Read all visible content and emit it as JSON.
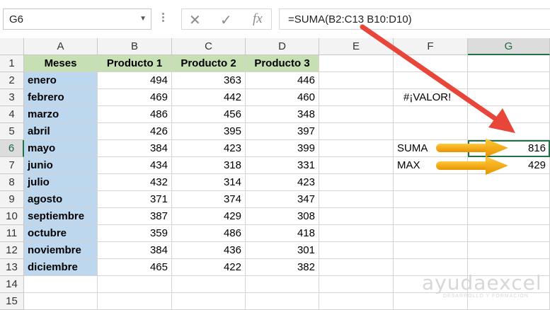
{
  "name_box": {
    "value": "G6"
  },
  "formula_bar": {
    "cancel_icon": "close-icon",
    "enter_icon": "check-icon",
    "function_label": "fx",
    "formula": "=SUMA(B2:C13 B10:D10)"
  },
  "columns": [
    "A",
    "B",
    "C",
    "D",
    "E",
    "F",
    "G"
  ],
  "rows": [
    "1",
    "2",
    "3",
    "4",
    "5",
    "6",
    "7",
    "8",
    "9",
    "10",
    "11",
    "12",
    "13",
    "14",
    "15"
  ],
  "sheet": {
    "headers": [
      "Meses",
      "Producto 1",
      "Producto 2",
      "Producto 3"
    ],
    "data": [
      [
        "enero",
        "494",
        "363",
        "446"
      ],
      [
        "febrero",
        "469",
        "442",
        "460"
      ],
      [
        "marzo",
        "486",
        "456",
        "348"
      ],
      [
        "abril",
        "426",
        "395",
        "397"
      ],
      [
        "mayo",
        "384",
        "423",
        "399"
      ],
      [
        "junio",
        "434",
        "318",
        "331"
      ],
      [
        "julio",
        "432",
        "314",
        "423"
      ],
      [
        "agosto",
        "371",
        "374",
        "347"
      ],
      [
        "septiembre",
        "387",
        "429",
        "308"
      ],
      [
        "octubre",
        "359",
        "486",
        "418"
      ],
      [
        "noviembre",
        "384",
        "436",
        "301"
      ],
      [
        "diciembre",
        "465",
        "422",
        "382"
      ]
    ],
    "error_cell": "#¡VALOR!",
    "suma_label": "SUMA",
    "suma_value": "816",
    "max_label": "MAX",
    "max_value": "429"
  },
  "watermark": {
    "main": "ayudaexcel",
    "sub": "DESARROLLO Y FORMACIÓN"
  },
  "colors": {
    "header_green": "#c6e0b4",
    "month_blue": "#bdd7ee",
    "arrow_red": "#e8463b",
    "arrow_orange": "#f0a400",
    "excel_green": "#217346"
  }
}
